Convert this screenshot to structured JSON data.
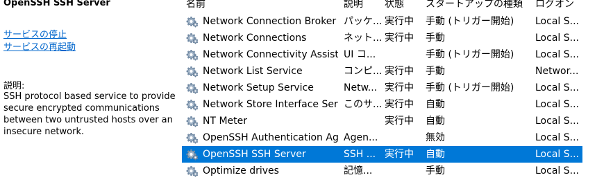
{
  "details": {
    "service_title": "OpenSSH SSH Server",
    "stop_link": "サービスの停止",
    "restart_link": "サービスの再起動",
    "description_label": "説明:",
    "description": "SSH protocol based service to provide secure encrypted communications between two untrusted hosts over an insecure network."
  },
  "columns": {
    "name": "名前",
    "description": "説明",
    "status": "状態",
    "startup_type": "スタートアップの種類",
    "logon": "ログオン"
  },
  "rows": [
    {
      "name": "Network Connection Broker",
      "description": "パッケ...",
      "status": "実行中",
      "startup_type": "手動 (トリガー開始)",
      "logon": "Local S..."
    },
    {
      "name": "Network Connections",
      "description": "ネット...",
      "status": "実行中",
      "startup_type": "手動",
      "logon": "Local S..."
    },
    {
      "name": "Network Connectivity Assist...",
      "description": "UI コ...",
      "status": "",
      "startup_type": "手動 (トリガー開始)",
      "logon": "Local S..."
    },
    {
      "name": "Network List Service",
      "description": "コンピ...",
      "status": "実行中",
      "startup_type": "手動",
      "logon": "Networ..."
    },
    {
      "name": "Network Setup Service",
      "description": "Netw...",
      "status": "実行中",
      "startup_type": "手動 (トリガー開始)",
      "logon": "Local S..."
    },
    {
      "name": "Network Store Interface Serv...",
      "description": "このサ...",
      "status": "実行中",
      "startup_type": "自動",
      "logon": "Local S..."
    },
    {
      "name": "NT Meter",
      "description": "",
      "status": "実行中",
      "startup_type": "自動",
      "logon": "Local S..."
    },
    {
      "name": "OpenSSH Authentication Ag...",
      "description": "Agen...",
      "status": "",
      "startup_type": "無効",
      "logon": "Local S..."
    },
    {
      "name": "OpenSSH SSH Server",
      "description": "SSH ...",
      "status": "実行中",
      "startup_type": "自動",
      "logon": "Local S...",
      "selected": true
    },
    {
      "name": "Optimize drives",
      "description": "記憶...",
      "status": "",
      "startup_type": "手動",
      "logon": "Local S..."
    }
  ],
  "colors": {
    "selection": "#0078d7",
    "link": "#0066cc"
  },
  "icons": {
    "service": "gear-service-icon"
  }
}
